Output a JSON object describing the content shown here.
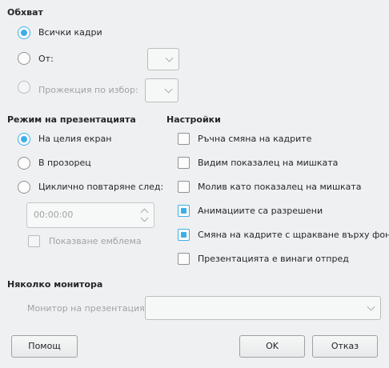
{
  "scope": {
    "heading": "Обхват",
    "all_slides": "Всички кадри",
    "from": "От:",
    "custom_show": "Прожекция по избор:"
  },
  "presentation_mode": {
    "heading": "Режим на презентацията",
    "fullscreen": "На целия екран",
    "window": "В прозорец",
    "loop": "Циклично повтаряне след:",
    "loop_time": "00:00:00",
    "show_logo": "Показване емблема"
  },
  "settings": {
    "heading": "Настройки",
    "items": [
      {
        "label": "Ръчна смяна на кадрите",
        "checked": false
      },
      {
        "label": "Видим показалец на мишката",
        "checked": false
      },
      {
        "label": "Молив като показалец на мишката",
        "checked": false
      },
      {
        "label": "Анимациите са разрешени",
        "checked": true
      },
      {
        "label": "Смяна на кадрите с щракване върху фона",
        "checked": true
      },
      {
        "label": "Презентацията е винаги отпред",
        "checked": false
      }
    ]
  },
  "multiple_monitors": {
    "heading": "Няколко монитора",
    "monitor_label": "Монитор на презентацията"
  },
  "buttons": {
    "help": "Помощ",
    "ok": "OK",
    "cancel": "Отказ"
  },
  "colors": {
    "accent": "#3daee9",
    "background": "#eff0f1"
  }
}
